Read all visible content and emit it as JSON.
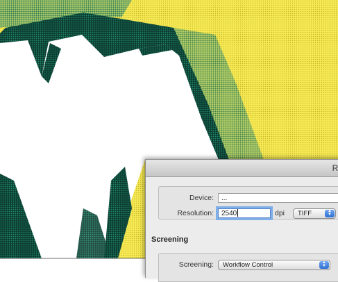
{
  "dialog": {
    "title": "Ras",
    "device_label": "Device:",
    "device_value": "...",
    "resolution_label": "Resolution:",
    "resolution_value": "2540",
    "resolution_unit": "dpi",
    "format_value": "TIFF",
    "screening_section": "Screening",
    "screening_label": "Screening:",
    "screening_value": "Workflow Control"
  },
  "colors": {
    "halftone_yellow": "#f2e64a",
    "halftone_dark": "#0f4a3c",
    "focus_ring": "#7faee8",
    "popup_arrow_blue": "#2d6ed1"
  },
  "icons": {
    "popup_arrows": "updown-arrows-icon"
  }
}
